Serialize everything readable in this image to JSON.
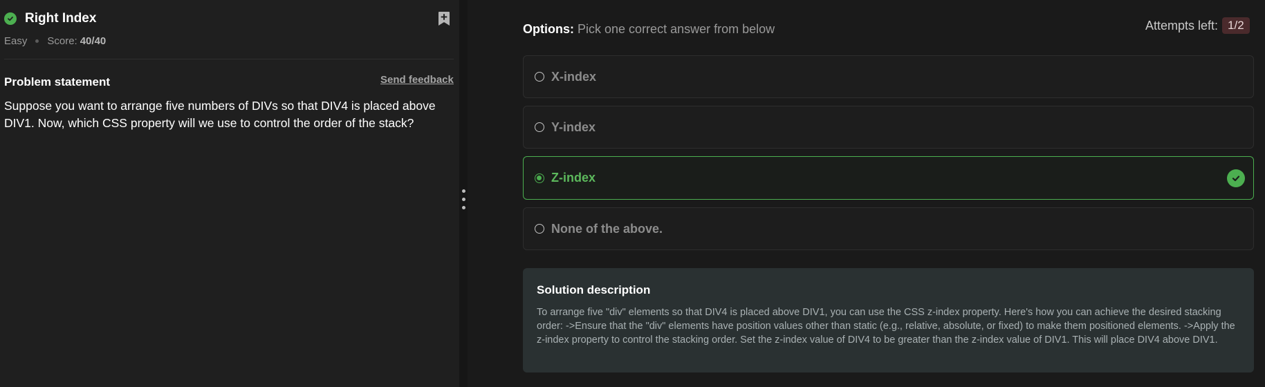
{
  "problem": {
    "title": "Right Index",
    "difficulty": "Easy",
    "score_label": "Score:",
    "score_value": "40/40",
    "statement_heading": "Problem statement",
    "feedback_link": "Send feedback",
    "statement": "Suppose you want to arrange five numbers of DIVs so that DIV4 is placed above DIV1. Now, which CSS property will we use to control the order of the stack?"
  },
  "options_section": {
    "label": "Options:",
    "instruction": "Pick one correct answer from below",
    "attempts_label": "Attempts left:",
    "attempts_value": "1/2",
    "items": [
      {
        "label": "X-index",
        "selected": false,
        "correct": false
      },
      {
        "label": "Y-index",
        "selected": false,
        "correct": false
      },
      {
        "label": "Z-index",
        "selected": true,
        "correct": true
      },
      {
        "label": "None of the above.",
        "selected": false,
        "correct": false
      }
    ]
  },
  "solution": {
    "title": "Solution description",
    "text": "To arrange five \"div\" elements so that DIV4 is placed above DIV1, you can use the CSS z-index property. Here's how you can achieve the desired stacking order: ->Ensure that the \"div\" elements have position values other than static (e.g., relative, absolute, or fixed) to make them positioned elements. ->Apply the z-index property to control the stacking order. Set the z-index value of DIV4 to be greater than the z-index value of DIV1. This will place DIV4 above DIV1."
  },
  "icons": {
    "solved": "check-circle-icon",
    "bookmark": "bookmark-add-icon",
    "splitter": "vertical-dots-icon",
    "correct": "check-circle-icon"
  },
  "colors": {
    "success": "#4caf50",
    "attempts_badge": "#4a2a2c",
    "solution_bg": "#2a3132"
  }
}
